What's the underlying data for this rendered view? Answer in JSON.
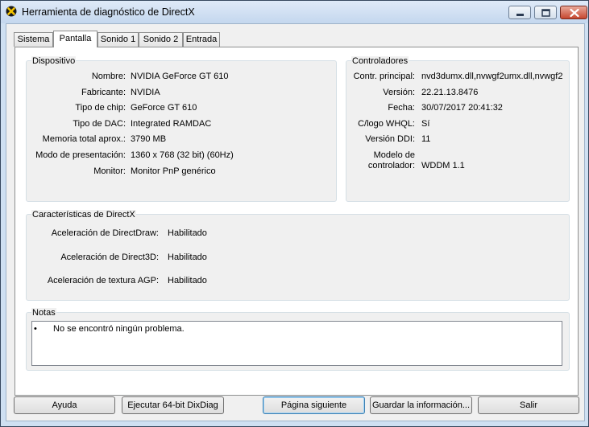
{
  "window": {
    "title": "Herramienta de diagnóstico de DirectX"
  },
  "tabs": [
    {
      "label": "Sistema"
    },
    {
      "label": "Pantalla",
      "active": true
    },
    {
      "label": "Sonido 1"
    },
    {
      "label": "Sonido 2"
    },
    {
      "label": "Entrada"
    }
  ],
  "device": {
    "title": "Dispositivo",
    "rows": [
      {
        "label": "Nombre:",
        "value": "NVIDIA GeForce GT 610"
      },
      {
        "label": "Fabricante:",
        "value": "NVIDIA"
      },
      {
        "label": "Tipo de chip:",
        "value": "GeForce GT 610"
      },
      {
        "label": "Tipo de DAC:",
        "value": "Integrated RAMDAC"
      },
      {
        "label": "Memoria total aprox.:",
        "value": "3790 MB"
      },
      {
        "label": "Modo de presentación:",
        "value": "1360 x 768 (32 bit) (60Hz)"
      },
      {
        "label": "Monitor:",
        "value": "Monitor PnP genérico"
      }
    ]
  },
  "drivers": {
    "title": "Controladores",
    "rows": [
      {
        "label": "Contr. principal:",
        "value": "nvd3dumx.dll,nvwgf2umx.dll,nvwgf2"
      },
      {
        "label": "Versión:",
        "value": "22.21.13.8476"
      },
      {
        "label": "Fecha:",
        "value": "30/07/2017 20:41:32"
      },
      {
        "label": "C/logo WHQL:",
        "value": "Sí"
      },
      {
        "label": "Versión DDI:",
        "value": "11"
      }
    ],
    "model_label_1": "Modelo de",
    "model_label_2": "controlador:",
    "model_value": "WDDM 1.1"
  },
  "features": {
    "title": "Características de DirectX",
    "rows": [
      {
        "label": "Aceleración de DirectDraw:",
        "value": "Habilitado"
      },
      {
        "label": "Aceleración de Direct3D:",
        "value": "Habilitado"
      },
      {
        "label": "Aceleración de textura AGP:",
        "value": "Habilitado"
      }
    ]
  },
  "notes": {
    "title": "Notas",
    "bullet": "•",
    "text": "No se encontró ningún problema."
  },
  "buttons": {
    "help": "Ayuda",
    "dxdiag64": "Ejecutar 64-bit DixDiag",
    "next": "Página siguiente",
    "save": "Guardar la información...",
    "exit": "Salir"
  }
}
